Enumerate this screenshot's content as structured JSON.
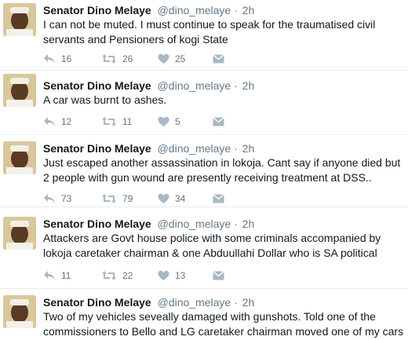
{
  "tweets": [
    {
      "name": "Senator Dino Melaye",
      "handle": "@dino_melaye",
      "separator": "·",
      "time": "2h",
      "text": "I can not be muted. I must continue to speak for the traumatised civil servants and Pensioners of kogi State",
      "replies": "16",
      "retweets": "26",
      "likes": "25"
    },
    {
      "name": "Senator Dino Melaye",
      "handle": "@dino_melaye",
      "separator": "·",
      "time": "2h",
      "text": "A car was burnt to ashes.",
      "replies": "12",
      "retweets": "11",
      "likes": "5"
    },
    {
      "name": "Senator Dino Melaye",
      "handle": "@dino_melaye",
      "separator": "·",
      "time": "2h",
      "text": "Just escaped another assassination in lokoja. Cant say if anyone died but 2 people with gun wound are presently receiving treatment at DSS..",
      "replies": "73",
      "retweets": "79",
      "likes": "34"
    },
    {
      "name": "Senator Dino Melaye",
      "handle": "@dino_melaye",
      "separator": "·",
      "time": "2h",
      "text": "Attackers are Govt house police with some criminals accompanied by lokoja caretaker chairman & one Abduullahi Dollar who is SA political",
      "replies": "11",
      "retweets": "22",
      "likes": "13"
    },
    {
      "name": "Senator Dino Melaye",
      "handle": "@dino_melaye",
      "separator": "·",
      "time": "2h",
      "text": "Two of my vehicles seveally damaged with gunshots. Told one of the commissioners to Bello and LG caretaker chairman moved one of my cars",
      "replies": "",
      "retweets": "",
      "likes": ""
    }
  ],
  "icons": {
    "reply": "reply-arrow-icon",
    "retweet": "retweet-icon",
    "like": "heart-icon",
    "message": "envelope-icon"
  },
  "colors": {
    "icon": "#aab8c2",
    "meta_text": "#657786",
    "body_text": "#14171a",
    "divider": "#e6ecf0"
  }
}
